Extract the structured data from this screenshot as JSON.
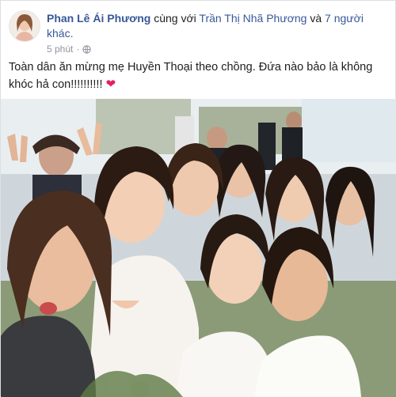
{
  "post": {
    "author": "Phan Lê Ái Phương",
    "with_text": " cùng với ",
    "tagged_person": "Trần Thị Nhã Phương",
    "and_text": " và ",
    "others": "7 người khác.",
    "time": "5 phút",
    "privacy_icon": "globe-icon",
    "caption": "Toàn dân ăn mừng mẹ Huyền Thoại theo chồng. Đứa nào bảo là không khóc hả con!!!!!!!!!! ",
    "heart": "❤"
  },
  "colors": {
    "link": "#385898",
    "meta": "#90949c",
    "heart": "#e0245e"
  }
}
